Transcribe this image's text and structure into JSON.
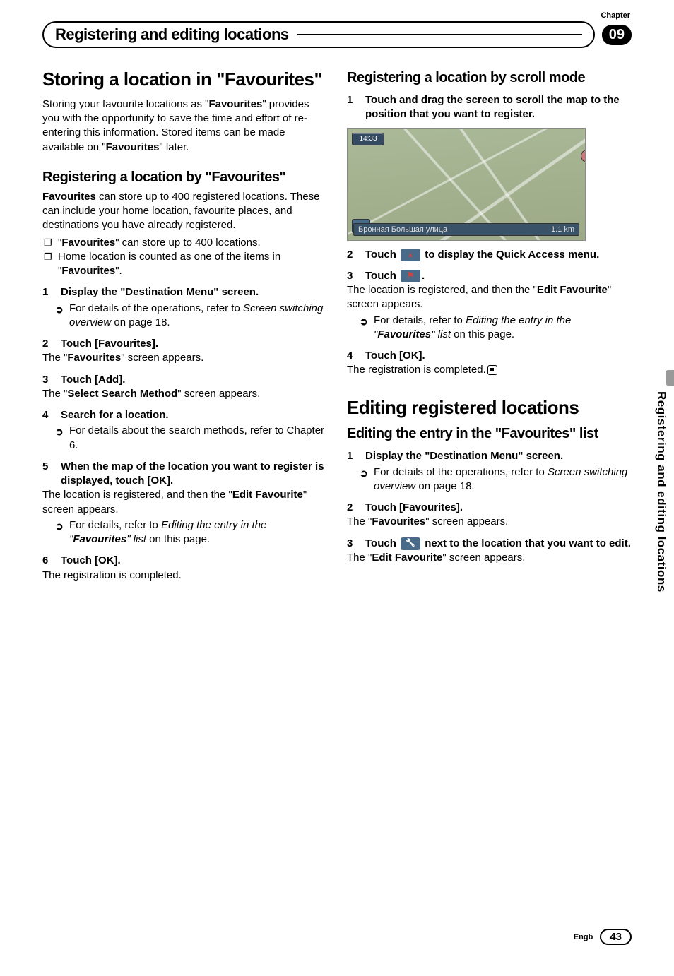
{
  "header": {
    "chapter_label": "Chapter",
    "title": "Registering and editing locations",
    "chapter_num": "09"
  },
  "side_tab": "Registering and editing locations",
  "left": {
    "sec1_title": "Storing a location in \"Favourites",
    "sec1_para_pre": "Storing your favourite locations as \"",
    "sec1_para_b1": "Favourites",
    "sec1_para_mid": "\" provides you with the opportunity to save the time and effort of re-entering this information. Stored items can be made available on \"",
    "sec1_para_b2": "Favourites",
    "sec1_para_post": "\" later.",
    "sub1_title": "Registering a location by \"Favourites\"",
    "sub1_para_b": "Favourites",
    "sub1_para": " can store up to 400 registered locations. These can include your home location, favourite places, and destinations you have already registered.",
    "bullet1_pre": "\"",
    "bullet1_b": "Favourites",
    "bullet1_post": "\" can store up to 400 locations.",
    "bullet2_pre": "Home location is counted as one of the items in \"",
    "bullet2_b": "Favourites",
    "bullet2_post": "\".",
    "s1_head": "Display the \"Destination Menu\" screen.",
    "s1_ref": "For details of the operations, refer to ",
    "s1_ref_i": "Screen switching overview",
    "s1_ref_post": " on page 18.",
    "s2_head": "Touch [Favourites].",
    "s2_body_pre": "The \"",
    "s2_body_b": "Favourites",
    "s2_body_post": "\" screen appears.",
    "s3_head": "Touch [Add].",
    "s3_body_pre": "The \"",
    "s3_body_b": "Select Search Method",
    "s3_body_post": "\" screen appears.",
    "s4_head": "Search for a location.",
    "s4_ref": "For details about the search methods, refer to Chapter 6.",
    "s5_head": "When the map of the location you want to register is displayed, touch [OK].",
    "s5_body_pre": "The location is registered, and then the \"",
    "s5_body_b": "Edit Favourite",
    "s5_body_post": "\" screen appears.",
    "s5_ref_pre": "For details, refer to ",
    "s5_ref_i_pre": "Editing the entry in the \"",
    "s5_ref_i_b": "Favourites",
    "s5_ref_i_post": "\" list",
    "s5_ref_post": " on this page.",
    "s6_head": "Touch [OK].",
    "s6_body": "The registration is completed."
  },
  "right": {
    "sub2_title": "Registering a location by scroll mode",
    "r1_head": "Touch and drag the screen to scroll the map to the position that you want to register.",
    "map_time": "14:33",
    "map_street": "Бронная Большая улица",
    "map_dist": "1.1 km",
    "r2_pre": "Touch ",
    "r2_post": " to display the Quick Access menu.",
    "r3_pre": "Touch ",
    "r3_post": ".",
    "r3_body_pre": "The location is registered, and then the \"",
    "r3_body_b": "Edit Favourite",
    "r3_body_post": "\" screen appears.",
    "r3_ref_pre": "For details, refer to ",
    "r3_ref_i_pre": "Editing the entry in the \"",
    "r3_ref_i_b": "Favourites",
    "r3_ref_i_post": "\" list",
    "r3_ref_post": " on this page.",
    "r4_head": "Touch [OK].",
    "r4_body": "The registration is completed.",
    "sec2_title": "Editing registered locations",
    "sub3_title": "Editing the entry in the \"Favourites\" list",
    "e1_head": "Display the \"Destination Menu\" screen.",
    "e1_ref": "For details of the operations, refer to ",
    "e1_ref_i": "Screen switching overview",
    "e1_ref_post": " on page 18.",
    "e2_head": "Touch [Favourites].",
    "e2_body_pre": "The \"",
    "e2_body_b": "Favourites",
    "e2_body_post": "\" screen appears.",
    "e3_pre": "Touch ",
    "e3_post": " next to the location that you want to edit.",
    "e3_body_pre": "The \"",
    "e3_body_b": "Edit Favourite",
    "e3_body_post": "\" screen appears."
  },
  "footer": {
    "lang": "Engb",
    "page": "43"
  }
}
